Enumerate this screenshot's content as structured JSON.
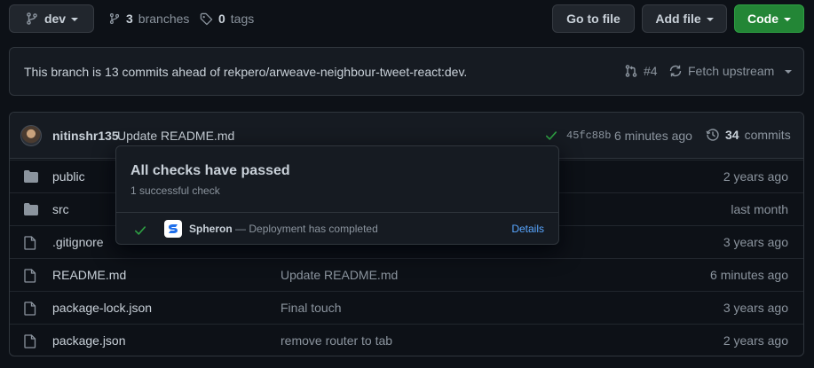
{
  "toolbar": {
    "branch_button": "dev",
    "branches_count": "3",
    "branches_label": "branches",
    "tags_count": "0",
    "tags_label": "tags",
    "go_to_file": "Go to file",
    "add_file": "Add file",
    "code": "Code"
  },
  "branch_status": {
    "message": "This branch is 13 commits ahead of rekpero/arweave-neighbour-tweet-react:dev.",
    "pr_link": "#4",
    "fetch_upstream": "Fetch upstream"
  },
  "latest_commit": {
    "author": "nitinshr135",
    "message": "Update README.md",
    "sha": "45fc88b",
    "time": "6 minutes ago",
    "commits_count": "34",
    "commits_label": "commits"
  },
  "files": [
    {
      "type": "folder",
      "name": "public",
      "message": "",
      "age": "2 years ago"
    },
    {
      "type": "folder",
      "name": "src",
      "message": "",
      "age": "last month"
    },
    {
      "type": "file",
      "name": ".gitignore",
      "message": "",
      "age": "3 years ago"
    },
    {
      "type": "file",
      "name": "README.md",
      "message": "Update README.md",
      "age": "6 minutes ago"
    },
    {
      "type": "file",
      "name": "package-lock.json",
      "message": "Final touch",
      "age": "3 years ago"
    },
    {
      "type": "file",
      "name": "package.json",
      "message": "remove router to tab",
      "age": "2 years ago"
    }
  ],
  "checks_popover": {
    "title": "All checks have passed",
    "subtitle": "1 successful check",
    "check_name": "Spheron",
    "check_status": "— Deployment has completed",
    "details": "Details"
  },
  "colors": {
    "background": "#0d1117",
    "success": "#2ea043",
    "link": "#58a6ff",
    "code_button": "#238636"
  },
  "icons": {
    "branch": "git-branch-icon",
    "tag": "tag-icon",
    "pull_request": "git-pull-request-icon",
    "sync": "sync-icon",
    "history": "history-icon",
    "check": "check-icon",
    "folder": "folder-icon",
    "file": "file-icon"
  }
}
